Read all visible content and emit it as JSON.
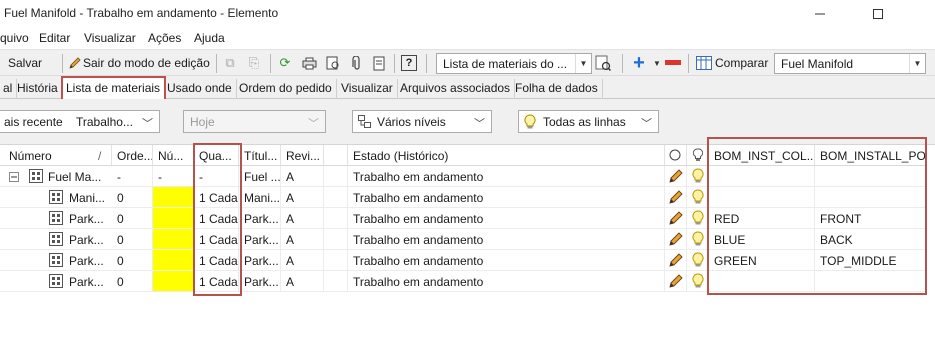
{
  "window": {
    "title": "Fuel Manifold - Trabalho em andamento - Elemento"
  },
  "menu": [
    "quivo",
    "Editar",
    "Visualizar",
    "Ações",
    "Ajuda"
  ],
  "toolbar": {
    "save_label": "Salvar",
    "exit_edit_label": "Sair do modo de edição",
    "view_combo": "Lista de materiais do ...",
    "compare_label": "Comparar",
    "compare_combo": "Fuel Manifold"
  },
  "tabs": [
    "al",
    "História",
    "Lista de materiais",
    "Usado onde",
    "Ordem do pedido",
    "Visualizar",
    "Arquivos associados",
    "Folha de dados"
  ],
  "filters": {
    "recent": "ais recente",
    "state": "Trabalho...",
    "date": "Hoje",
    "levels": "Vários níveis",
    "lines": "Todas as linhas"
  },
  "grid": {
    "headers": {
      "numero": "Número",
      "sort": "/",
      "ordem": "Orde...",
      "numero2": "Nú...",
      "quantidade": "Qua...",
      "titulo": "Títul...",
      "revisao": "Revi...",
      "estado": "Estado (Histórico)",
      "bom_inst_col": "BOM_INST_COL...",
      "bom_install_pos": "BOM_INSTALL_POS"
    },
    "rows": [
      {
        "numero": "Fuel Ma...",
        "ordem": "-",
        "num": "-",
        "qtd": "-",
        "titulo": "Fuel ...",
        "rev": "A",
        "estado": "Trabalho em andamento",
        "col": "",
        "pos": "",
        "expander": "⊟",
        "yellow": false
      },
      {
        "numero": "Mani...",
        "ordem": "0",
        "num": "",
        "qtd": "1 Cada",
        "titulo": "Mani...",
        "rev": "A",
        "estado": "Trabalho em andamento",
        "col": "",
        "pos": "",
        "yellow": true
      },
      {
        "numero": "Park...",
        "ordem": "0",
        "num": "",
        "qtd": "1 Cada",
        "titulo": "Park...",
        "rev": "A",
        "estado": "Trabalho em andamento",
        "col": "RED",
        "pos": "FRONT",
        "yellow": true
      },
      {
        "numero": "Park...",
        "ordem": "0",
        "num": "",
        "qtd": "1 Cada",
        "titulo": "Park...",
        "rev": "A",
        "estado": "Trabalho em andamento",
        "col": "BLUE",
        "pos": "BACK",
        "yellow": true
      },
      {
        "numero": "Park...",
        "ordem": "0",
        "num": "",
        "qtd": "1 Cada",
        "titulo": "Park...",
        "rev": "A",
        "estado": "Trabalho em andamento",
        "col": "GREEN",
        "pos": "TOP_MIDDLE",
        "yellow": true
      },
      {
        "numero": "Park...",
        "ordem": "0",
        "num": "",
        "qtd": "1 Cada",
        "titulo": "Park...",
        "rev": "A",
        "estado": "Trabalho em andamento",
        "col": "",
        "pos": "",
        "yellow": true
      }
    ]
  },
  "colors": {
    "highlight": "#b5524e",
    "cell_yellow": "#ffff00",
    "toolbar_bg": "#f0f0f0"
  }
}
